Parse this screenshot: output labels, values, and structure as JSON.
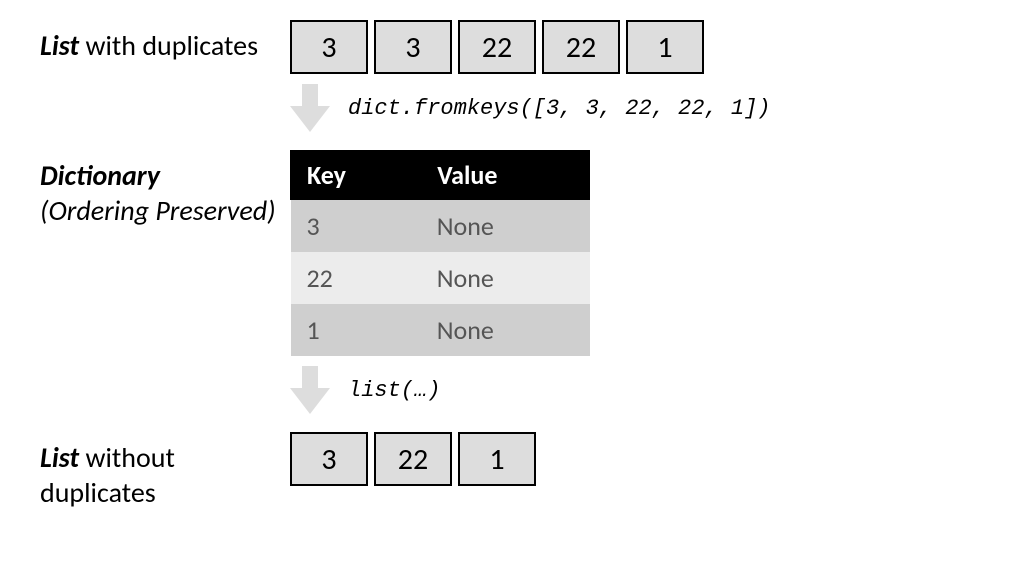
{
  "labels": {
    "list_dup_bold": "List",
    "list_dup_rest": " with duplicates",
    "dict_bold": "Dictionary",
    "dict_sub": "(Ordering Preserved)",
    "list_nodup_bold": "List",
    "list_nodup_rest": " without duplicates"
  },
  "code": {
    "fromkeys": "dict.fromkeys([3, 3, 22, 22, 1])",
    "list": "list(…)"
  },
  "list_with_dup": [
    "3",
    "3",
    "22",
    "22",
    "1"
  ],
  "dict_table": {
    "headers": {
      "key": "Key",
      "value": "Value"
    },
    "rows": [
      {
        "key": "3",
        "value": "None"
      },
      {
        "key": "22",
        "value": "None"
      },
      {
        "key": "1",
        "value": "None"
      }
    ]
  },
  "list_no_dup": [
    "3",
    "22",
    "1"
  ],
  "chart_data": {
    "type": "table",
    "input_list": [
      3,
      3,
      22,
      22,
      1
    ],
    "dictionary": {
      "3": null,
      "22": null,
      "1": null
    },
    "output_list": [
      3,
      22,
      1
    ]
  }
}
